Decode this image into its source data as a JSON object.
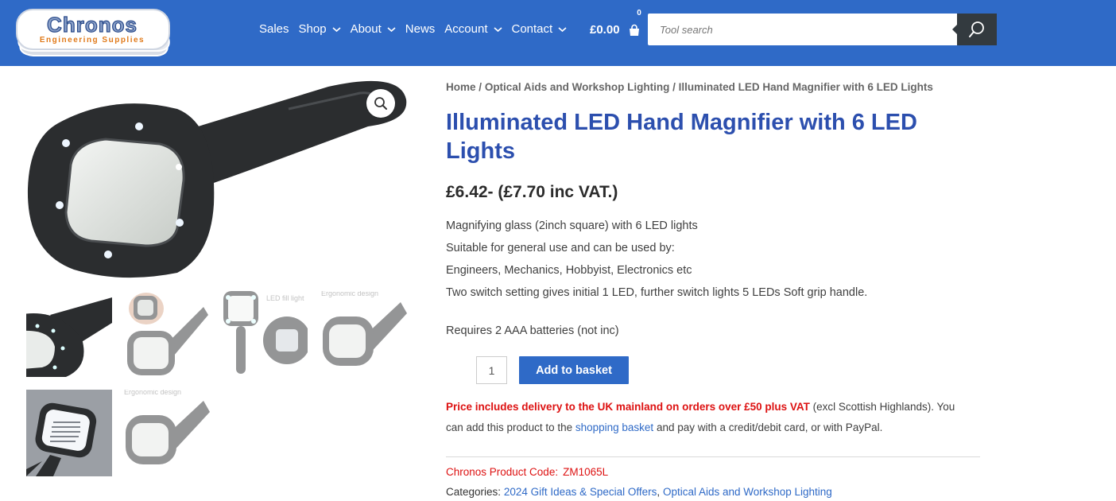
{
  "header": {
    "logo": {
      "name": "Chronos",
      "tagline": "Engineering Supplies"
    },
    "nav": [
      {
        "label": "Sales",
        "has_dropdown": false
      },
      {
        "label": "Shop",
        "has_dropdown": true
      },
      {
        "label": "About",
        "has_dropdown": true
      },
      {
        "label": "News",
        "has_dropdown": false
      },
      {
        "label": "Account",
        "has_dropdown": true
      },
      {
        "label": "Contact",
        "has_dropdown": true
      }
    ],
    "cart": {
      "total": "£0.00",
      "count": "0",
      "icon": "shopping-bag-icon"
    },
    "search": {
      "placeholder": "Tool search",
      "value": "",
      "icon": "search-icon"
    }
  },
  "gallery": {
    "zoom_icon": "magnifier-zoom-icon",
    "thumbnails": [
      {
        "caption": ""
      },
      {
        "caption": ""
      },
      {
        "caption": "LED fill light"
      },
      {
        "caption": "Ergonomic design"
      },
      {
        "caption": ""
      },
      {
        "caption": "Ergonomic design"
      }
    ]
  },
  "product": {
    "breadcrumb": {
      "home": "Home",
      "category": "Optical Aids and Workshop Lighting",
      "current": "Illuminated LED Hand Magnifier with 6 LED Lights",
      "separator": "/"
    },
    "title": "Illuminated LED Hand Magnifier with 6 LED Lights",
    "price": "£6.42- (£7.70 inc VAT.)",
    "description": [
      "Magnifying glass (2inch square) with 6 LED lights",
      "Suitable for general use and can be used by:",
      "Engineers, Mechanics, Hobbyist, Electronics etc",
      "Two switch setting gives initial 1 LED, further switch lights 5 LEDs Soft grip handle."
    ],
    "batteries": "Requires 2 AAA batteries (not inc)",
    "quantity": "1",
    "add_to_basket": "Add to basket",
    "delivery": {
      "highlight": "Price includes delivery to the UK mainland on orders over £50 plus VAT",
      "text1": " (excl Scottish Highlands). You can add this product to the ",
      "link": "shopping basket",
      "text2": " and pay with a credit/debit card, or with PayPal."
    },
    "product_code_label": "Chronos Product Code:",
    "product_code": "ZM1065L",
    "categories_label": "Categories:",
    "categories": [
      "2024 Gift Ideas & Special Offers",
      "Optical Aids and Workshop Lighting"
    ],
    "categories_separator": ", "
  },
  "colors": {
    "header_bg": "#2f6ac7",
    "title": "#2c4fae",
    "accent_red": "#dd1111",
    "link": "#2f6ac7",
    "search_button": "#333a3f"
  }
}
